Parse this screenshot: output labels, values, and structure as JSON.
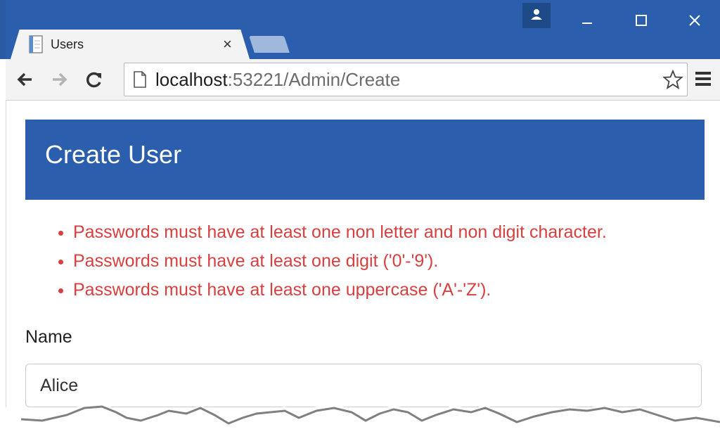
{
  "browser": {
    "tab_title": "Users",
    "tab_close": "×",
    "url_host": "localhost",
    "url_path": ":53221/Admin/Create",
    "min_glyph": "–",
    "max_glyph": "☐",
    "close_glyph": "✕"
  },
  "page": {
    "title": "Create User",
    "errors": [
      "Passwords must have at least one non letter and non digit character.",
      "Passwords must have at least one digit ('0'-'9').",
      "Passwords must have at least one uppercase ('A'-'Z')."
    ],
    "name_label": "Name",
    "name_value": "Alice"
  },
  "colors": {
    "brand": "#2b5fad",
    "error": "#d84040"
  }
}
